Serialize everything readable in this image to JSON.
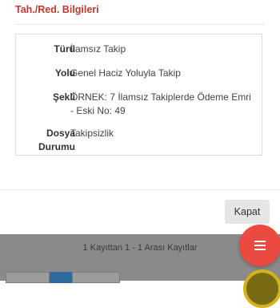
{
  "modal": {
    "title": "Tah./Red. Bilgileri",
    "rows": [
      {
        "label": "Türü",
        "value": "İlamsız Takip"
      },
      {
        "label": "Yolu",
        "value": "Genel Haciz Yoluyla Takip"
      },
      {
        "label": "Şekli",
        "value": "ÖRNEK: 7 İlamsız Takiplerde Ödeme Emri - Eski No: 49"
      },
      {
        "label": "Dosya Durumu",
        "value": "Takipsizlik"
      }
    ],
    "close_label": "Kapat"
  },
  "background": {
    "record_info": "1 Kayıttan 1 - 1 Arası Kayıtlar"
  },
  "fab": {
    "icon": "menu-icon"
  },
  "colors": {
    "title": "#c0392b",
    "fab": "#ea4a3f",
    "backdrop": "#8a8a8a",
    "active_page": "#2f6a9f"
  }
}
